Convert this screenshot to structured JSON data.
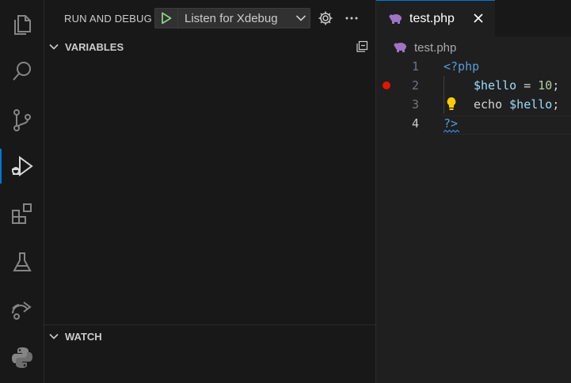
{
  "activity_bar": {
    "items": [
      {
        "icon": "files-icon"
      },
      {
        "icon": "search-icon"
      },
      {
        "icon": "source-control-icon"
      },
      {
        "icon": "run-debug-icon"
      },
      {
        "icon": "extensions-icon"
      },
      {
        "icon": "testing-icon"
      },
      {
        "icon": "remote-explorer-icon"
      },
      {
        "icon": "python-icon"
      }
    ]
  },
  "sidebar": {
    "title": "RUN AND DEBUG",
    "launch_config": "Listen for Xdebug",
    "sections": {
      "variables": "VARIABLES",
      "watch": "WATCH"
    }
  },
  "editor": {
    "tab_label": "test.php",
    "breadcrumb": "test.php",
    "lines": [
      {
        "number": "1",
        "code": "<?php"
      },
      {
        "number": "2",
        "var": "$hello",
        "op": " = ",
        "num": "10",
        "end": ";"
      },
      {
        "number": "3",
        "kw": "echo",
        "var": "$hello",
        "end": ";"
      },
      {
        "number": "4",
        "code": "?>"
      }
    ]
  },
  "colors": {
    "accent": "#0078d4",
    "breakpoint": "#e51400",
    "play_green": "#89d185",
    "php_purple": "#a074c4",
    "bulb_yellow": "#ffcc00"
  }
}
